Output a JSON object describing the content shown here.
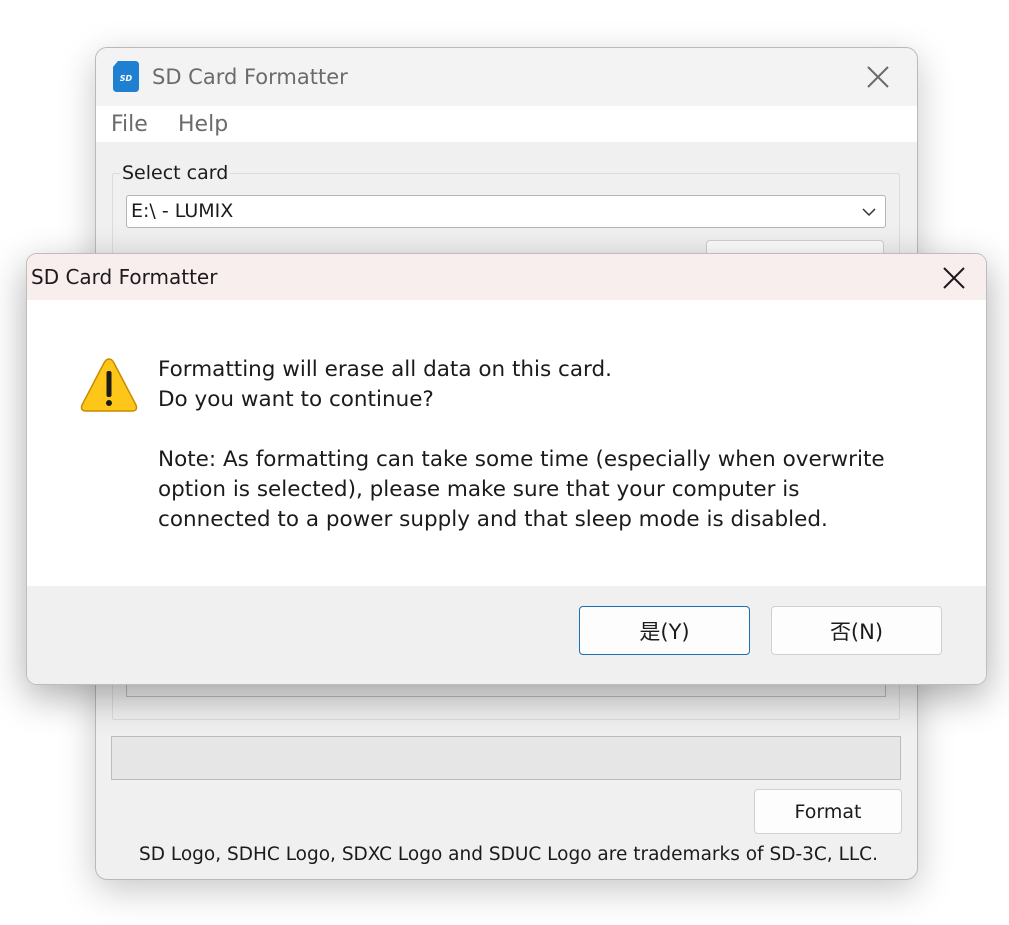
{
  "main_window": {
    "title": "SD Card Formatter",
    "menu": [
      {
        "label": "File"
      },
      {
        "label": "Help"
      }
    ],
    "select_card_label": "Select card",
    "selected_card": "E:\\ - LUMIX",
    "format_label": "Format",
    "trademark_text": "SD Logo, SDHC Logo, SDXC Logo and SDUC Logo are trademarks of SD-3C, LLC."
  },
  "dialog": {
    "title": "SD Card Formatter",
    "message_lines": [
      "Formatting will erase all data on this card.",
      "Do you want to continue?"
    ],
    "note_lines": [
      "Note: As formatting can take some time (especially when overwrite",
      "option is selected), please make sure that your computer is",
      "connected to a power supply and that sleep mode is disabled."
    ],
    "yes_label": "是(Y)",
    "no_label": "否(N)"
  },
  "icons": {
    "app": "sd-card-icon",
    "warning": "warning-icon",
    "close": "close-icon",
    "dropdown": "chevron-down-icon"
  },
  "colors": {
    "dialog_titlebar": "#f9eeee",
    "default_button_border": "#1b6fb3",
    "app_icon_blue": "#1f7fd1",
    "warning_yellow": "#ffc61a"
  }
}
